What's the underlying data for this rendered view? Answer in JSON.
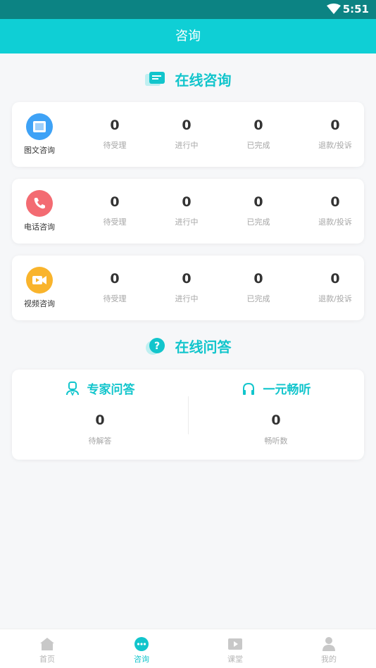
{
  "status_bar": {
    "time": "5:51"
  },
  "header": {
    "title": "咨询"
  },
  "online_consult": {
    "title": "在线咨询",
    "rows": [
      {
        "label": "图文咨询",
        "icon": "image-icon",
        "color": "#3ea2f6",
        "stats": [
          {
            "value": "0",
            "label": "待受理"
          },
          {
            "value": "0",
            "label": "进行中"
          },
          {
            "value": "0",
            "label": "已完成"
          },
          {
            "value": "0",
            "label": "退款/投诉"
          }
        ]
      },
      {
        "label": "电话咨询",
        "icon": "phone-icon",
        "color": "#f36b72",
        "stats": [
          {
            "value": "0",
            "label": "待受理"
          },
          {
            "value": "0",
            "label": "进行中"
          },
          {
            "value": "0",
            "label": "已完成"
          },
          {
            "value": "0",
            "label": "退款/投诉"
          }
        ]
      },
      {
        "label": "视频咨询",
        "icon": "video-icon",
        "color": "#f9b42c",
        "stats": [
          {
            "value": "0",
            "label": "待受理"
          },
          {
            "value": "0",
            "label": "进行中"
          },
          {
            "value": "0",
            "label": "已完成"
          },
          {
            "value": "0",
            "label": "退款/投诉"
          }
        ]
      }
    ]
  },
  "online_qa": {
    "title": "在线问答",
    "expert": {
      "title": "专家问答",
      "value": "0",
      "label": "待解答"
    },
    "listen": {
      "title": "一元畅听",
      "value": "0",
      "label": "畅听数"
    }
  },
  "tabbar": {
    "tabs": [
      {
        "label": "首页",
        "icon": "home-icon"
      },
      {
        "label": "咨询",
        "icon": "chat-icon",
        "active": true
      },
      {
        "label": "课堂",
        "icon": "play-icon"
      },
      {
        "label": "我的",
        "icon": "user-icon"
      }
    ]
  },
  "colors": {
    "accent": "#0fcfd5",
    "status_bar": "#0c8383"
  }
}
